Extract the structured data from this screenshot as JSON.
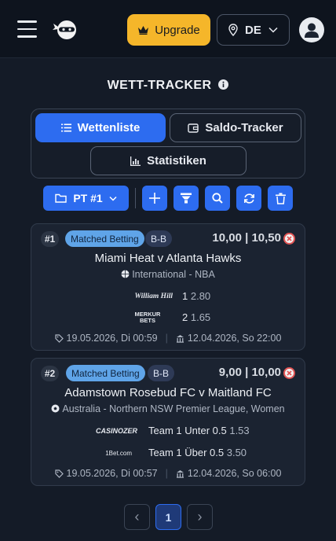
{
  "header": {
    "upgrade_label": "Upgrade",
    "language": "DE"
  },
  "page_title": "WETT-TRACKER",
  "tabs": [
    {
      "label": "Wettenliste",
      "active": true
    },
    {
      "label": "Saldo-Tracker",
      "active": false
    },
    {
      "label": "Statistiken",
      "active": false
    }
  ],
  "toolbar": {
    "folder_label": "PT #1"
  },
  "bets": [
    {
      "index": "#1",
      "type": "Matched Betting",
      "mode": "B-B",
      "odds": "10,00 | 10,50",
      "event": "Miami Heat v Atlanta Hawks",
      "league": "International - NBA",
      "sport_icon": "basketball-icon",
      "selections": [
        {
          "bookmaker": "William Hill",
          "pick": "1",
          "odds": "2.80"
        },
        {
          "bookmaker": "Merkur Bets",
          "pick": "2",
          "odds": "1.65"
        }
      ],
      "created": "19.05.2026, Di 00:59",
      "event_date": "12.04.2026, So 22:00"
    },
    {
      "index": "#2",
      "type": "Matched Betting",
      "mode": "B-B",
      "odds": "9,00 | 10,00",
      "event": "Adamstown Rosebud FC v Maitland FC",
      "league": "Australia - Northern NSW Premier League, Women",
      "sport_icon": "soccer-ball-icon",
      "selections": [
        {
          "bookmaker": "Casinozer",
          "pick": "Team 1 Unter 0.5",
          "odds": "1.53"
        },
        {
          "bookmaker": "1Bet.com",
          "pick": "Team 1 Über 0.5",
          "odds": "3.50"
        }
      ],
      "created": "19.05.2026, Di 00:57",
      "event_date": "12.04.2026, So 06:00"
    }
  ],
  "pagination": {
    "current_page": "1",
    "prev": "‹",
    "next": "›"
  },
  "colors": {
    "accent": "#2d6cf0",
    "upgrade": "#f5b62a",
    "background": "#141b27",
    "card": "#1b2331",
    "badge_matched": "#5fa4e8",
    "remove": "#e25555"
  }
}
